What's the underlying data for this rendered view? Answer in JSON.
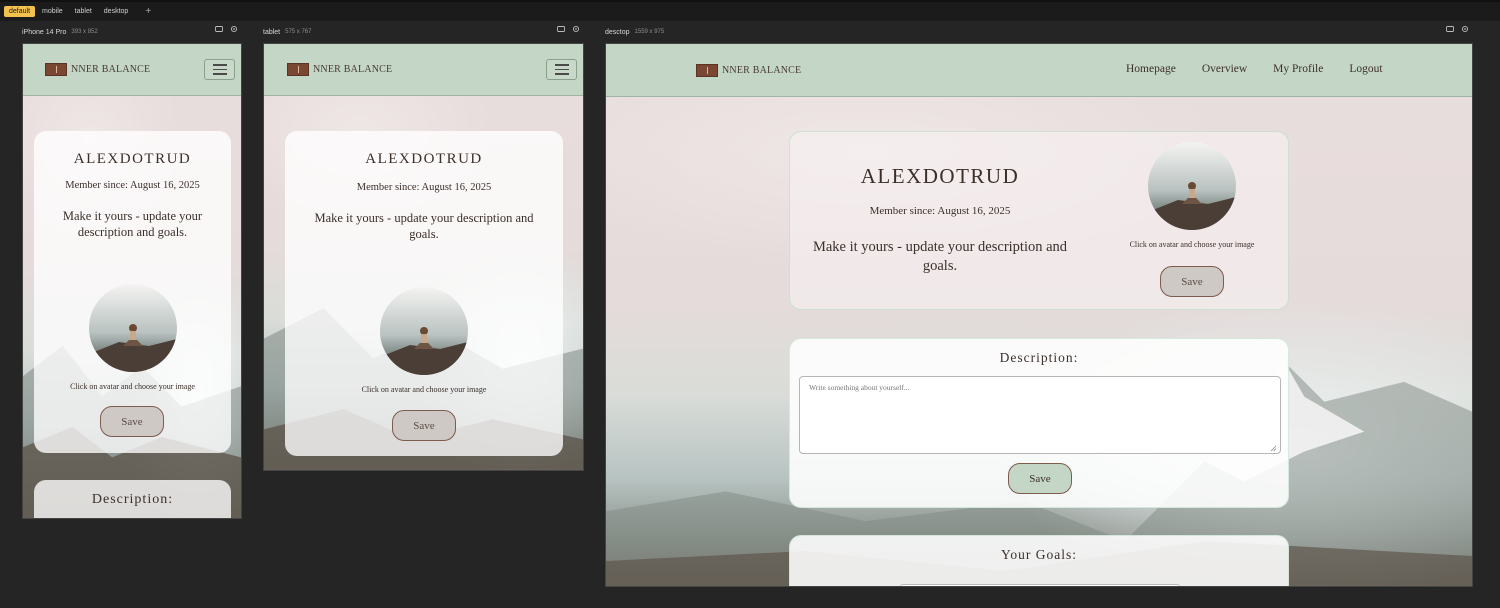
{
  "toolbar": {
    "tabs": [
      {
        "label": "default",
        "active": true
      },
      {
        "label": "mobile"
      },
      {
        "label": "tablet"
      },
      {
        "label": "desktop"
      }
    ],
    "add_label": "+"
  },
  "frames": {
    "mobile": {
      "name": "iPhone 14 Pro",
      "size": "393 x 852"
    },
    "tablet": {
      "name": "tablet",
      "size": "575 x 767"
    },
    "desktop": {
      "name": "desctop",
      "size": "1559 x 975"
    }
  },
  "site": {
    "logo_text": "NNER BALANCE",
    "nav": [
      "Homepage",
      "Overview",
      "My Profile",
      "Logout"
    ]
  },
  "profile": {
    "username": "ALEXDOTRUD",
    "member_since": "Member since: August 16, 2025",
    "tagline": "Make it yours - update your description and goals.",
    "avatar_hint": "Click on avatar and choose your image",
    "save_label": "Save"
  },
  "description": {
    "title": "Description:",
    "placeholder": "Write something about yourself...",
    "save_label": "Save"
  },
  "goals": {
    "title": "Your Goals:"
  },
  "colors": {
    "nav_bg": "#c4d6c6",
    "logo": "#7a4733",
    "accent_button": "#c4d6c6",
    "text": "#3b2f2a",
    "active_tab": "#f2c14e"
  }
}
